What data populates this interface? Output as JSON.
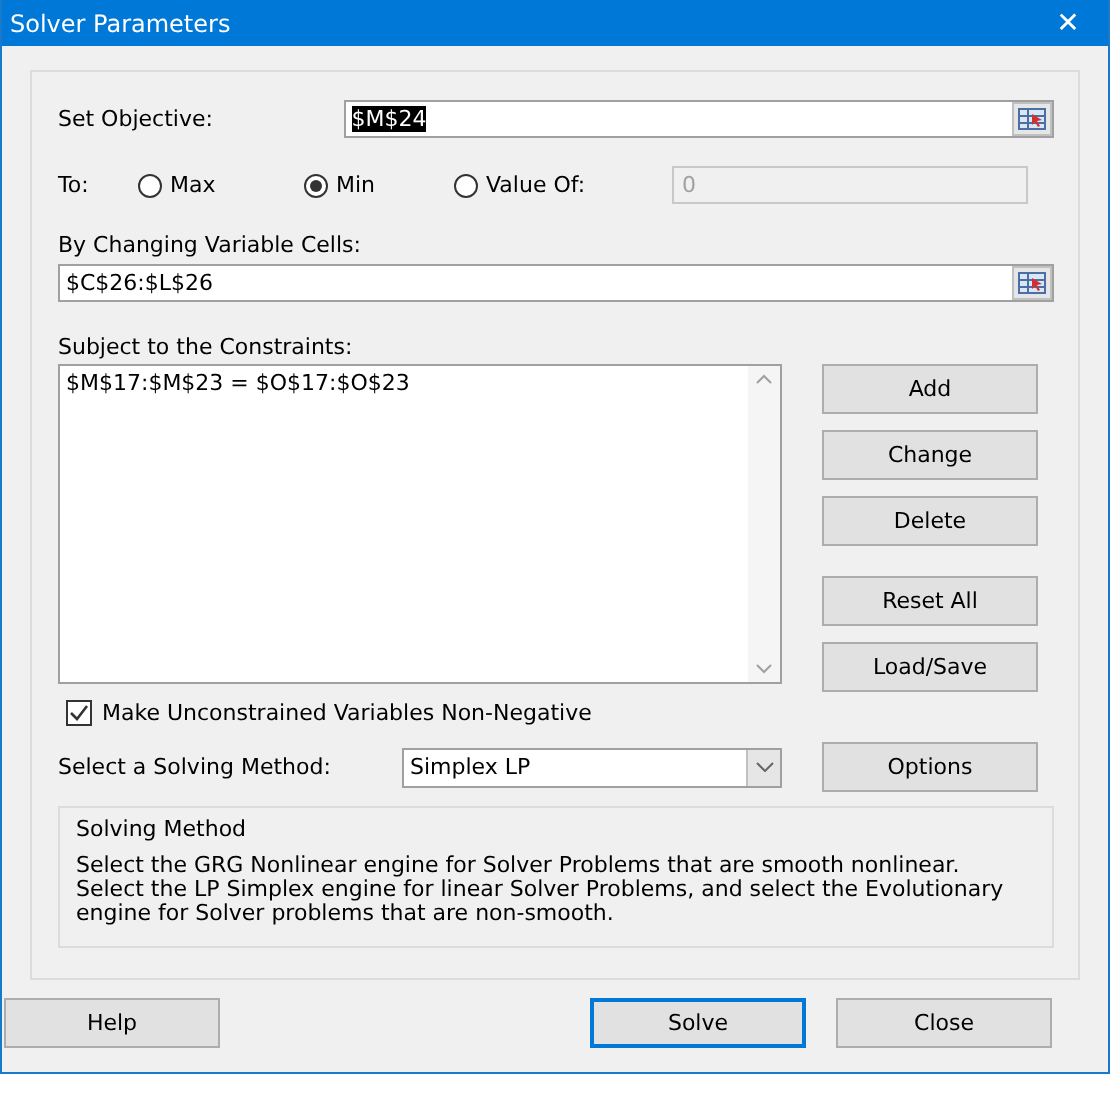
{
  "window": {
    "title": "Solver Parameters",
    "close_glyph": "✕"
  },
  "objective": {
    "label": "Set Objective:",
    "value": "$M$24",
    "selected": true
  },
  "to": {
    "label": "To:",
    "options": [
      {
        "label": "Max",
        "selected": false
      },
      {
        "label": "Min",
        "selected": true
      },
      {
        "label": "Value Of:",
        "selected": false
      }
    ],
    "value_of": {
      "value": "0",
      "disabled": true
    }
  },
  "changing_cells": {
    "label": "By Changing Variable Cells:",
    "value": "$C$26:$L$26"
  },
  "constraints": {
    "label": "Subject to the Constraints:",
    "items": [
      "$M$17:$M$23 = $O$17:$O$23"
    ]
  },
  "constraint_button_groups": [
    [
      "Add",
      "Change",
      "Delete"
    ],
    [
      "Reset All",
      "Load/Save"
    ]
  ],
  "non_negative": {
    "label": "Make Unconstrained Variables Non-Negative",
    "checked": true
  },
  "method": {
    "label": "Select a Solving Method:",
    "value": "Simplex LP",
    "options_button": "Options"
  },
  "description": {
    "title": "Solving Method",
    "text": "Select the GRG Nonlinear engine for Solver Problems that are smooth nonlinear. Select the LP Simplex engine for linear Solver Problems, and select the Evolutionary engine for Solver problems that are non-smooth."
  },
  "footer_buttons": [
    {
      "label": "Help",
      "default": false
    },
    {
      "label": "Solve",
      "default": true
    },
    {
      "label": "Close",
      "default": false
    }
  ]
}
